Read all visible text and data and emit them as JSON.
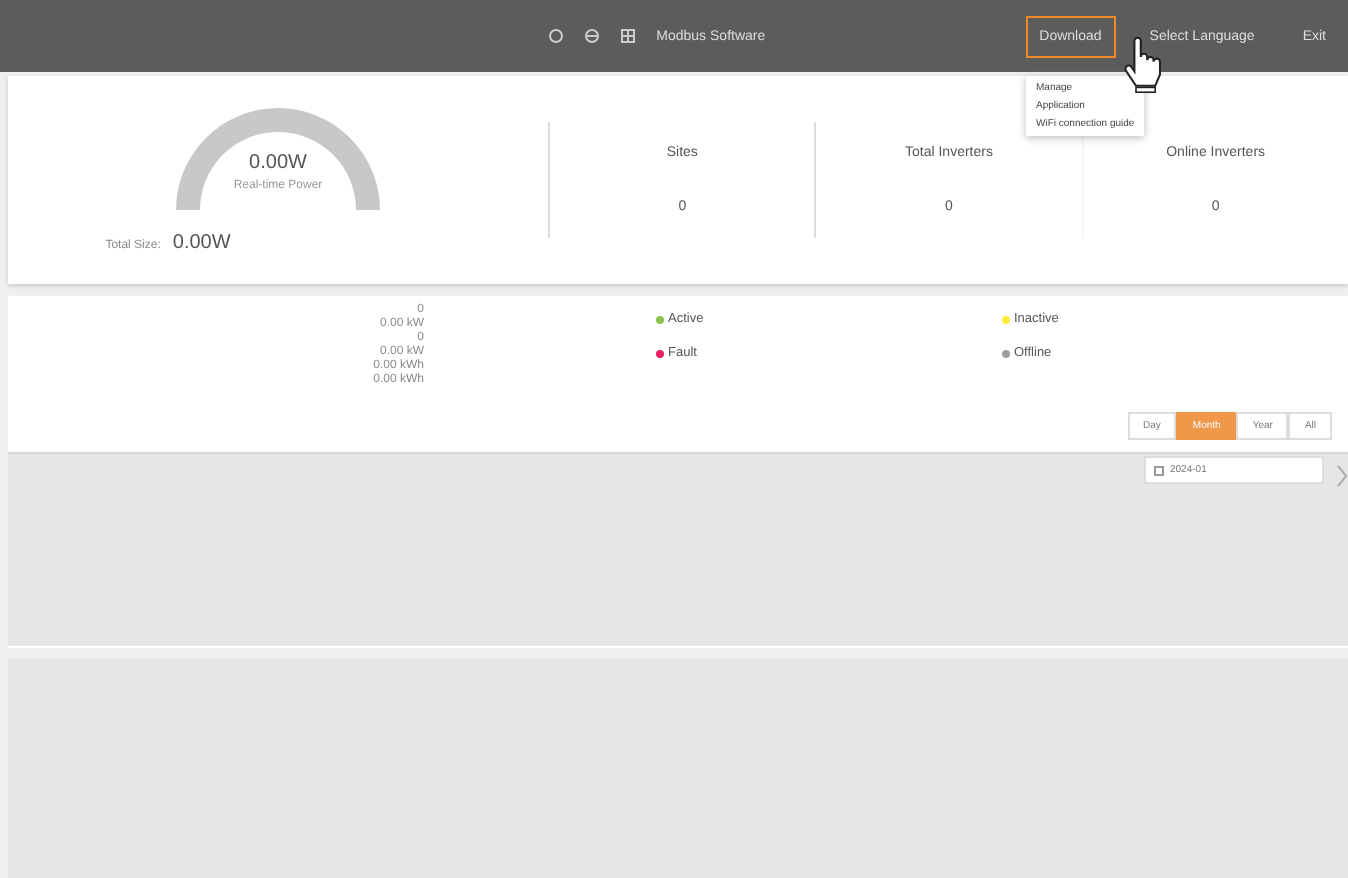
{
  "topbar": {
    "app_title": "Modbus Software",
    "menus": [
      {
        "label": "Download",
        "selected": true
      },
      {
        "label": "Select Language",
        "selected": false
      },
      {
        "label": "Exit",
        "selected": false
      }
    ]
  },
  "dropdown": {
    "items": [
      "Manage",
      "Application",
      "WiFi connection guide"
    ]
  },
  "summary": {
    "power": "0.00W",
    "power_label": "Real-time Power",
    "size_label": "Total Size:",
    "size_value": "0.00W",
    "stats": [
      {
        "label": "Sites",
        "value": "0"
      },
      {
        "label": "Total Inverters",
        "value": "0"
      },
      {
        "label": "Online Inverters",
        "value": "0"
      }
    ]
  },
  "details": {
    "readings": [
      "0",
      "0.00 kW",
      "0",
      "0.00 kW",
      "0.00 kWh",
      "0.00 kWh"
    ],
    "legend": [
      {
        "label": "Active",
        "color": "#8bc34a"
      },
      {
        "label": "Inactive",
        "color": "#ffeb3b"
      },
      {
        "label": "Fault",
        "color": "#e91e63"
      },
      {
        "label": "Offline",
        "color": "#9e9e9e"
      }
    ],
    "periods": [
      {
        "label": "Day",
        "selected": false
      },
      {
        "label": "Month",
        "selected": true
      },
      {
        "label": "Year",
        "selected": false
      },
      {
        "label": "All",
        "selected": false
      }
    ],
    "date": "2024-01"
  }
}
